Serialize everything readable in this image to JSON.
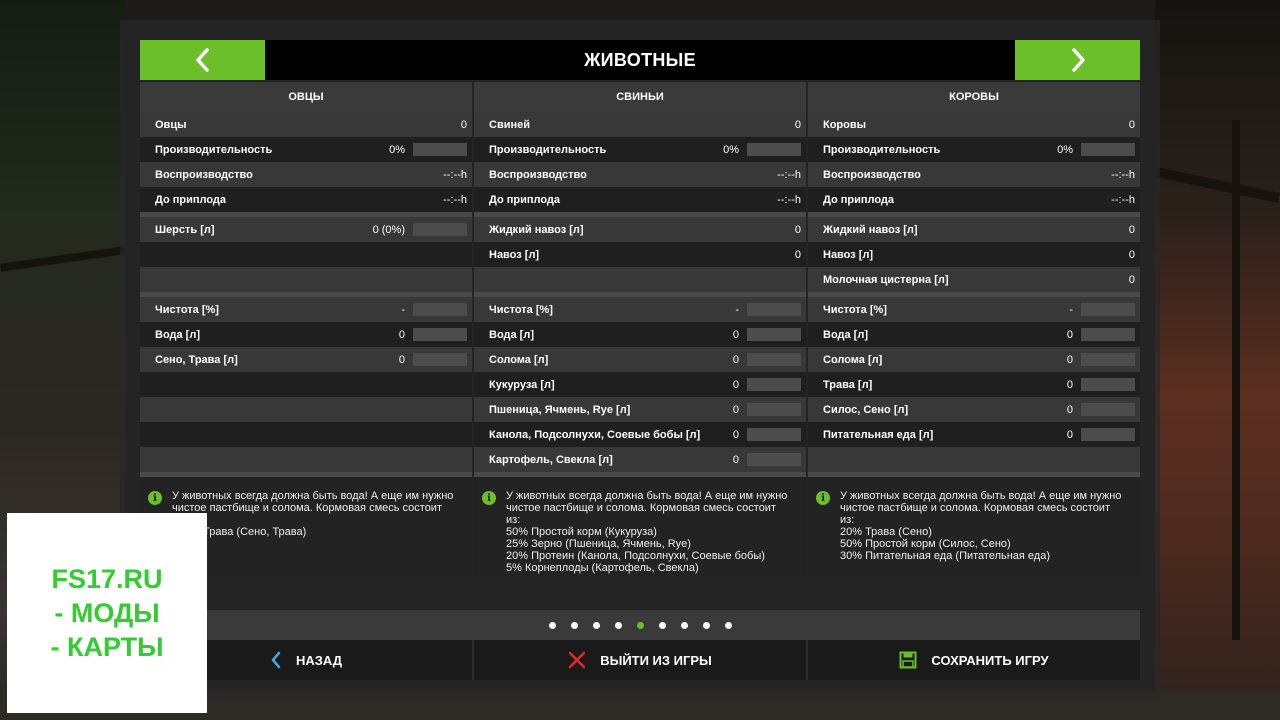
{
  "header": {
    "title": "ЖИВОТНЫЕ"
  },
  "columns": [
    {
      "name": "ОВЦЫ",
      "stats": [
        {
          "label": "Овцы",
          "value": "0",
          "bar": null
        },
        {
          "label": "Производительность",
          "value": "0%",
          "bar": 0
        },
        {
          "label": "Воспроизводство",
          "value": "--:--h",
          "bar": null
        },
        {
          "label": "До приплода",
          "value": "--:--h",
          "bar": null
        }
      ],
      "products": [
        {
          "label": "Шерсть [л]",
          "value": "0 (0%)",
          "bar": 0
        },
        {
          "label": "",
          "value": "",
          "bar": null
        },
        {
          "label": "",
          "value": "",
          "bar": null
        }
      ],
      "needs": [
        {
          "label": "Чистота [%]",
          "value": "-",
          "bar": 0
        },
        {
          "label": "Вода [л]",
          "value": "0",
          "bar": 0
        },
        {
          "label": "Сено, Трава [л]",
          "value": "0",
          "bar": 0
        },
        {
          "label": "",
          "value": "",
          "bar": null
        },
        {
          "label": "",
          "value": "",
          "bar": null
        },
        {
          "label": "",
          "value": "",
          "bar": null
        },
        {
          "label": "",
          "value": "",
          "bar": null
        }
      ],
      "info": "У животных всегда должна быть вода! А еще им нужно\nчистое пастбище и солома. Кормовая смесь состоит\nиз:\n100% Трава (Сено, Трава)"
    },
    {
      "name": "СВИНЬИ",
      "stats": [
        {
          "label": "Свиней",
          "value": "0",
          "bar": null
        },
        {
          "label": "Производительность",
          "value": "0%",
          "bar": 0
        },
        {
          "label": "Воспроизводство",
          "value": "--:--h",
          "bar": null
        },
        {
          "label": "До приплода",
          "value": "--:--h",
          "bar": null
        }
      ],
      "products": [
        {
          "label": "Жидкий навоз [л]",
          "value": "0",
          "bar": null
        },
        {
          "label": "Навоз [л]",
          "value": "0",
          "bar": null
        },
        {
          "label": "",
          "value": "",
          "bar": null
        }
      ],
      "needs": [
        {
          "label": "Чистота [%]",
          "value": "-",
          "bar": 0
        },
        {
          "label": "Вода [л]",
          "value": "0",
          "bar": 0
        },
        {
          "label": "Солома [л]",
          "value": "0",
          "bar": 0
        },
        {
          "label": "Кукуруза [л]",
          "value": "0",
          "bar": 0
        },
        {
          "label": "Пшеница, Ячмень, Rye [л]",
          "value": "0",
          "bar": 0
        },
        {
          "label": "Канола, Подсолнухи, Соевые бобы [л]",
          "value": "0",
          "bar": 0
        },
        {
          "label": "Картофель, Свекла [л]",
          "value": "0",
          "bar": 0
        }
      ],
      "info": "У животных всегда должна быть вода! А еще им нужно\nчистое пастбище и солома. Кормовая смесь состоит\nиз:\n50% Простой корм (Кукуруза)\n25% Зерно (Пшеница, Ячмень, Rye)\n20% Протеин (Канола, Подсолнухи, Соевые бобы)\n5% Корнеплоды (Картофель, Свекла)"
    },
    {
      "name": "КОРОВЫ",
      "stats": [
        {
          "label": "Коровы",
          "value": "0",
          "bar": null
        },
        {
          "label": "Производительность",
          "value": "0%",
          "bar": 0
        },
        {
          "label": "Воспроизводство",
          "value": "--:--h",
          "bar": null
        },
        {
          "label": "До приплода",
          "value": "--:--h",
          "bar": null
        }
      ],
      "products": [
        {
          "label": "Жидкий навоз [л]",
          "value": "0",
          "bar": null
        },
        {
          "label": "Навоз [л]",
          "value": "0",
          "bar": null
        },
        {
          "label": "Молочная цистерна [л]",
          "value": "0",
          "bar": null
        }
      ],
      "needs": [
        {
          "label": "Чистота [%]",
          "value": "-",
          "bar": 0
        },
        {
          "label": "Вода [л]",
          "value": "0",
          "bar": 0
        },
        {
          "label": "Солома [л]",
          "value": "0",
          "bar": 0
        },
        {
          "label": "Трава [л]",
          "value": "0",
          "bar": 0
        },
        {
          "label": "Силос, Сено [л]",
          "value": "0",
          "bar": 0
        },
        {
          "label": "Питательная еда [л]",
          "value": "0",
          "bar": 0
        },
        {
          "label": "",
          "value": "",
          "bar": null
        }
      ],
      "info": "У животных всегда должна быть вода! А еще им нужно\nчистое пастбище и солома. Кормовая смесь состоит\nиз:\n20% Трава (Сено)\n50% Простой корм (Силос, Сено)\n30% Питательная еда (Питательная еда)"
    }
  ],
  "pagination": {
    "total": 9,
    "active_index": 4
  },
  "footer": {
    "back_label": "НАЗАД",
    "quit_label": "ВЫЙТИ ИЗ ИГРЫ",
    "save_label": "СОХРАНИТЬ ИГРУ"
  },
  "watermark": {
    "line1": "FS17.RU",
    "line2": "- МОДЫ",
    "line3": "- КАРТЫ"
  },
  "colors": {
    "accent": "#6bbf29",
    "quit_icon": "#e02a2a",
    "back_icon": "#3fa9e0",
    "watermark_text": "#33cc33"
  },
  "icons": {
    "prev": "chevron-left-icon",
    "next": "chevron-right-icon",
    "info": "info-icon",
    "back": "chevron-left-icon",
    "quit": "close-icon",
    "save": "floppy-disk-icon"
  }
}
